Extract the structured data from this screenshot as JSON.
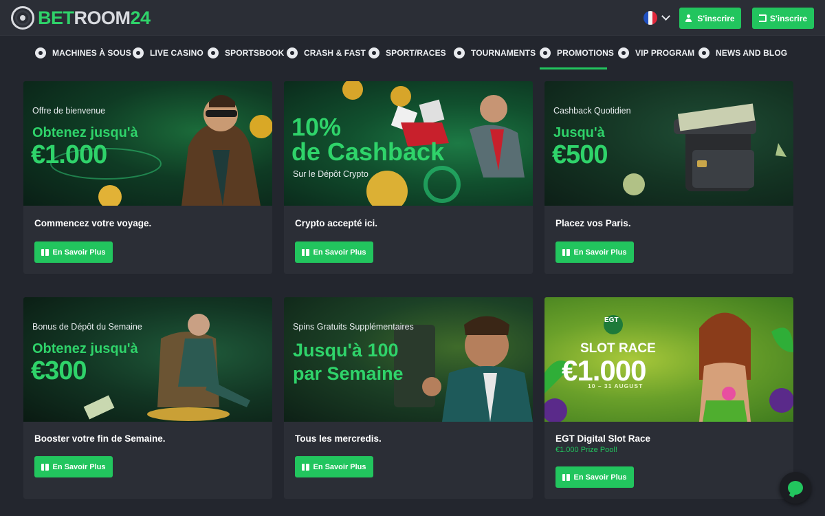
{
  "header": {
    "logo": {
      "part1": "BET",
      "part2": "ROOM",
      "part3": "24"
    },
    "signup_label": "S'inscrire",
    "signin_label": "S'inscrire"
  },
  "nav": {
    "items": [
      {
        "label": "MACHINES À SOUS",
        "icon": "slot-machine-icon"
      },
      {
        "label": "LIVE CASINO",
        "icon": "roulette-icon"
      },
      {
        "label": "SPORTSBOOK",
        "icon": "football-icon"
      },
      {
        "label": "CRASH & FAST",
        "icon": "rocket-icon"
      },
      {
        "label": "SPORT/RACES",
        "icon": "gamepad-icon"
      },
      {
        "label": "TOURNAMENTS",
        "icon": "trophy-icon"
      },
      {
        "label": "PROMOTIONS",
        "icon": "gift-icon"
      },
      {
        "label": "VIP PROGRAM",
        "icon": "crown-icon"
      },
      {
        "label": "NEWS AND BLOG",
        "icon": "news-icon"
      }
    ],
    "active": "PROMOTIONS"
  },
  "promos": [
    {
      "kicker": "Offre de bienvenue",
      "headline": "Obtenez jusqu'à",
      "amount": "€1.000",
      "title": "Commencez votre voyage.",
      "button": "En Savoir Plus"
    },
    {
      "headline": "10%",
      "amount": "de Cashback",
      "kicker": "Sur le Dépôt Crypto",
      "title": "Crypto accepté ici.",
      "button": "En Savoir Plus"
    },
    {
      "kicker": "Cashback Quotidien",
      "headline": "Jusqu'à",
      "amount": "€500",
      "title": "Placez vos Paris.",
      "button": "En Savoir Plus"
    },
    {
      "kicker": "Bonus de Dépôt du Semaine",
      "headline": "Obtenez jusqu'à",
      "amount": "€300",
      "title": "Booster votre fin de Semaine.",
      "button": "En Savoir Plus"
    },
    {
      "kicker": "Spins Gratuits Supplémentaires",
      "headline": "Jusqu'à 100",
      "amount": "par Semaine",
      "title": "Tous les mercredis.",
      "button": "En Savoir Plus"
    },
    {
      "badge": "EGT",
      "headline": "SLOT RACE",
      "amount": "€1.000",
      "dates": "10 – 31 AUGUST",
      "title": "EGT Digital Slot Race",
      "subtitle": "€1.000 Prize Pool!",
      "button": "En Savoir Plus"
    }
  ],
  "colors": {
    "accent": "#22c55e",
    "background": "#23262e",
    "card": "#2b2e36"
  }
}
